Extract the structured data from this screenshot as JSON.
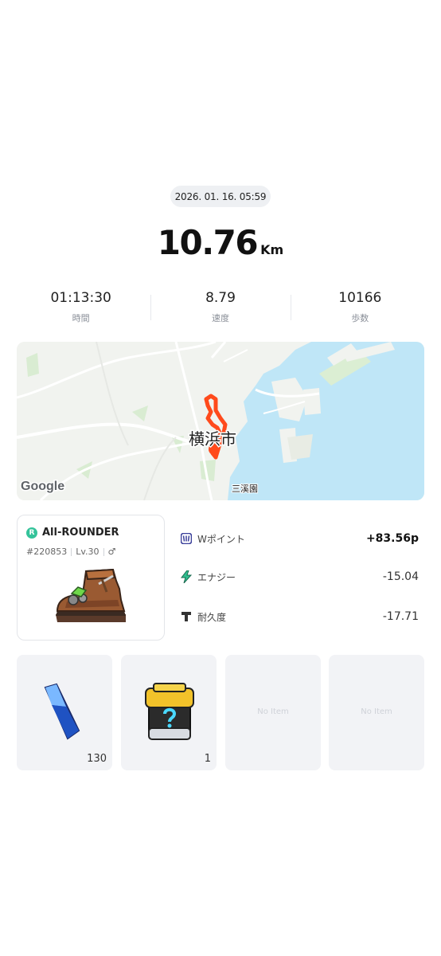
{
  "header": {
    "date": "2026. 01. 16. 05:59",
    "distance_value": "10.76",
    "distance_unit": "Km"
  },
  "stats": [
    {
      "value": "01:13:30",
      "label": "時間"
    },
    {
      "value": "8.79",
      "label": "速度"
    },
    {
      "value": "10166",
      "label": "歩数"
    }
  ],
  "map": {
    "city_label": "横浜市",
    "place_label": "三溪園",
    "provider": "Google",
    "colors": {
      "water": "#bfe6f7",
      "land": "#f1f3ef",
      "route": "#ff4a1c",
      "park": "#d9ecd2"
    }
  },
  "shoe": {
    "rarity_badge": "R",
    "name": "All-ROUNDER",
    "id": "#220853",
    "level": "Lv.30",
    "gender_symbol": "♂",
    "badge_color": "#34c39a"
  },
  "results": [
    {
      "icon": "w-point-icon",
      "label": "Wポイント",
      "value": "+83.56p"
    },
    {
      "icon": "energy-icon",
      "label": "エナジー",
      "value": "-15.04"
    },
    {
      "icon": "durability-icon",
      "label": "耐久度",
      "value": "-17.71"
    }
  ],
  "items": [
    {
      "name": "blue-gem",
      "count": "130"
    },
    {
      "name": "mystery-box",
      "count": "1"
    },
    {
      "empty_label": "No Item"
    },
    {
      "empty_label": "No Item"
    }
  ]
}
